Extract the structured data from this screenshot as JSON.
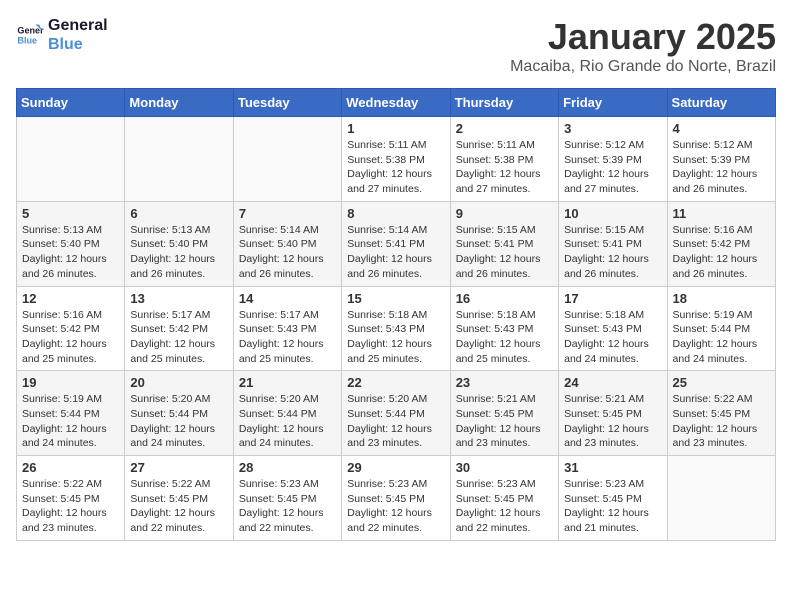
{
  "header": {
    "logo_line1": "General",
    "logo_line2": "Blue",
    "month": "January 2025",
    "location": "Macaiba, Rio Grande do Norte, Brazil"
  },
  "weekdays": [
    "Sunday",
    "Monday",
    "Tuesday",
    "Wednesday",
    "Thursday",
    "Friday",
    "Saturday"
  ],
  "weeks": [
    [
      {
        "day": "",
        "info": ""
      },
      {
        "day": "",
        "info": ""
      },
      {
        "day": "",
        "info": ""
      },
      {
        "day": "1",
        "info": "Sunrise: 5:11 AM\nSunset: 5:38 PM\nDaylight: 12 hours\nand 27 minutes."
      },
      {
        "day": "2",
        "info": "Sunrise: 5:11 AM\nSunset: 5:38 PM\nDaylight: 12 hours\nand 27 minutes."
      },
      {
        "day": "3",
        "info": "Sunrise: 5:12 AM\nSunset: 5:39 PM\nDaylight: 12 hours\nand 27 minutes."
      },
      {
        "day": "4",
        "info": "Sunrise: 5:12 AM\nSunset: 5:39 PM\nDaylight: 12 hours\nand 26 minutes."
      }
    ],
    [
      {
        "day": "5",
        "info": "Sunrise: 5:13 AM\nSunset: 5:40 PM\nDaylight: 12 hours\nand 26 minutes."
      },
      {
        "day": "6",
        "info": "Sunrise: 5:13 AM\nSunset: 5:40 PM\nDaylight: 12 hours\nand 26 minutes."
      },
      {
        "day": "7",
        "info": "Sunrise: 5:14 AM\nSunset: 5:40 PM\nDaylight: 12 hours\nand 26 minutes."
      },
      {
        "day": "8",
        "info": "Sunrise: 5:14 AM\nSunset: 5:41 PM\nDaylight: 12 hours\nand 26 minutes."
      },
      {
        "day": "9",
        "info": "Sunrise: 5:15 AM\nSunset: 5:41 PM\nDaylight: 12 hours\nand 26 minutes."
      },
      {
        "day": "10",
        "info": "Sunrise: 5:15 AM\nSunset: 5:41 PM\nDaylight: 12 hours\nand 26 minutes."
      },
      {
        "day": "11",
        "info": "Sunrise: 5:16 AM\nSunset: 5:42 PM\nDaylight: 12 hours\nand 26 minutes."
      }
    ],
    [
      {
        "day": "12",
        "info": "Sunrise: 5:16 AM\nSunset: 5:42 PM\nDaylight: 12 hours\nand 25 minutes."
      },
      {
        "day": "13",
        "info": "Sunrise: 5:17 AM\nSunset: 5:42 PM\nDaylight: 12 hours\nand 25 minutes."
      },
      {
        "day": "14",
        "info": "Sunrise: 5:17 AM\nSunset: 5:43 PM\nDaylight: 12 hours\nand 25 minutes."
      },
      {
        "day": "15",
        "info": "Sunrise: 5:18 AM\nSunset: 5:43 PM\nDaylight: 12 hours\nand 25 minutes."
      },
      {
        "day": "16",
        "info": "Sunrise: 5:18 AM\nSunset: 5:43 PM\nDaylight: 12 hours\nand 25 minutes."
      },
      {
        "day": "17",
        "info": "Sunrise: 5:18 AM\nSunset: 5:43 PM\nDaylight: 12 hours\nand 24 minutes."
      },
      {
        "day": "18",
        "info": "Sunrise: 5:19 AM\nSunset: 5:44 PM\nDaylight: 12 hours\nand 24 minutes."
      }
    ],
    [
      {
        "day": "19",
        "info": "Sunrise: 5:19 AM\nSunset: 5:44 PM\nDaylight: 12 hours\nand 24 minutes."
      },
      {
        "day": "20",
        "info": "Sunrise: 5:20 AM\nSunset: 5:44 PM\nDaylight: 12 hours\nand 24 minutes."
      },
      {
        "day": "21",
        "info": "Sunrise: 5:20 AM\nSunset: 5:44 PM\nDaylight: 12 hours\nand 24 minutes."
      },
      {
        "day": "22",
        "info": "Sunrise: 5:20 AM\nSunset: 5:44 PM\nDaylight: 12 hours\nand 23 minutes."
      },
      {
        "day": "23",
        "info": "Sunrise: 5:21 AM\nSunset: 5:45 PM\nDaylight: 12 hours\nand 23 minutes."
      },
      {
        "day": "24",
        "info": "Sunrise: 5:21 AM\nSunset: 5:45 PM\nDaylight: 12 hours\nand 23 minutes."
      },
      {
        "day": "25",
        "info": "Sunrise: 5:22 AM\nSunset: 5:45 PM\nDaylight: 12 hours\nand 23 minutes."
      }
    ],
    [
      {
        "day": "26",
        "info": "Sunrise: 5:22 AM\nSunset: 5:45 PM\nDaylight: 12 hours\nand 23 minutes."
      },
      {
        "day": "27",
        "info": "Sunrise: 5:22 AM\nSunset: 5:45 PM\nDaylight: 12 hours\nand 22 minutes."
      },
      {
        "day": "28",
        "info": "Sunrise: 5:23 AM\nSunset: 5:45 PM\nDaylight: 12 hours\nand 22 minutes."
      },
      {
        "day": "29",
        "info": "Sunrise: 5:23 AM\nSunset: 5:45 PM\nDaylight: 12 hours\nand 22 minutes."
      },
      {
        "day": "30",
        "info": "Sunrise: 5:23 AM\nSunset: 5:45 PM\nDaylight: 12 hours\nand 22 minutes."
      },
      {
        "day": "31",
        "info": "Sunrise: 5:23 AM\nSunset: 5:45 PM\nDaylight: 12 hours\nand 21 minutes."
      },
      {
        "day": "",
        "info": ""
      }
    ]
  ]
}
